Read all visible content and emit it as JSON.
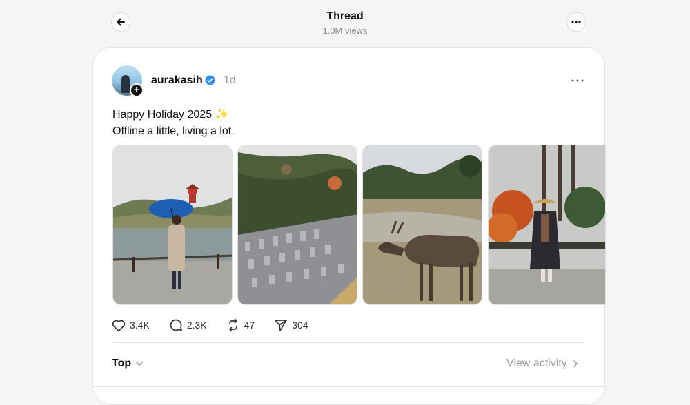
{
  "header": {
    "title": "Thread",
    "views": "1.0M views",
    "back_icon": "arrow-left-icon",
    "menu_icon": "more-horizontal-icon"
  },
  "post": {
    "username": "aurakasih",
    "verified": true,
    "timestamp": "1d",
    "caption_line1": "Happy Holiday 2025",
    "caption_emoji": "✨",
    "caption_line2": "Offline a little, living a lot.",
    "photos": [
      {
        "name": "photo-woman-umbrella-pagoda"
      },
      {
        "name": "photo-cemetery-hillside"
      },
      {
        "name": "photo-deer-park"
      },
      {
        "name": "photo-monk-straw-hat"
      }
    ],
    "stats": {
      "likes": "3.4K",
      "comments": "2.3K",
      "reposts": "47",
      "shares": "304"
    }
  },
  "footer": {
    "sort_label": "Top",
    "activity_label": "View activity"
  },
  "colors": {
    "background": "#f5f5f5",
    "card": "#ffffff",
    "verified_blue": "#2f8ff0",
    "muted_text": "#9a9a9a"
  }
}
